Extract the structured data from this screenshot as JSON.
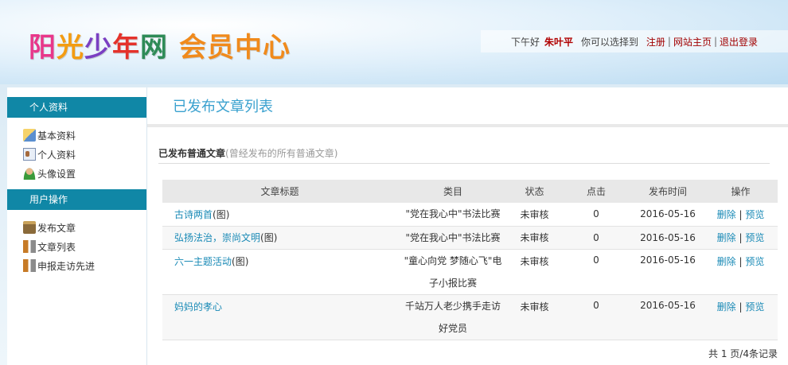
{
  "header": {
    "logo": [
      "阳",
      "光",
      "少",
      "年",
      "网",
      "会员中心"
    ],
    "greeting": "下午好",
    "username": "朱叶平",
    "choose_text": "你可以选择到",
    "links": [
      "注册",
      "网站主页",
      "退出登录"
    ]
  },
  "sidebar": {
    "sections": [
      {
        "title": "个人资料",
        "items": [
          "基本资料",
          "个人资料",
          "头像设置"
        ]
      },
      {
        "title": "用户操作",
        "items": [
          "发布文章",
          "文章列表",
          "申报走访先进"
        ]
      }
    ]
  },
  "main": {
    "title": "已发布文章列表",
    "section_label": "已发布普通文章",
    "section_note": "(曾经发布的所有普通文章)",
    "columns": [
      "文章标题",
      "类目",
      "状态",
      "点击",
      "发布时间",
      "操作"
    ],
    "rows": [
      {
        "title": "古诗两首",
        "suffix": "(图)",
        "category": "\"党在我心中\"书法比赛",
        "status": "未审核",
        "clicks": "0",
        "date": "2016-05-16",
        "delete": "删除",
        "preview": "预览"
      },
      {
        "title": "弘扬法治，崇尚文明",
        "suffix": "(图)",
        "category": "\"党在我心中\"书法比赛",
        "status": "未审核",
        "clicks": "0",
        "date": "2016-05-16",
        "delete": "删除",
        "preview": "预览"
      },
      {
        "title": "六一主题活动",
        "suffix": "(图)",
        "category": "\"童心向党 梦随心飞\"电子小报比赛",
        "status": "未审核",
        "clicks": "0",
        "date": "2016-05-16",
        "delete": "删除",
        "preview": "预览"
      },
      {
        "title": "妈妈的孝心",
        "suffix": "",
        "category": "千站万人老少携手走访好党员",
        "status": "未审核",
        "clicks": "0",
        "date": "2016-05-16",
        "delete": "删除",
        "preview": "预览"
      }
    ],
    "pager": "共 1 页/4条记录"
  }
}
